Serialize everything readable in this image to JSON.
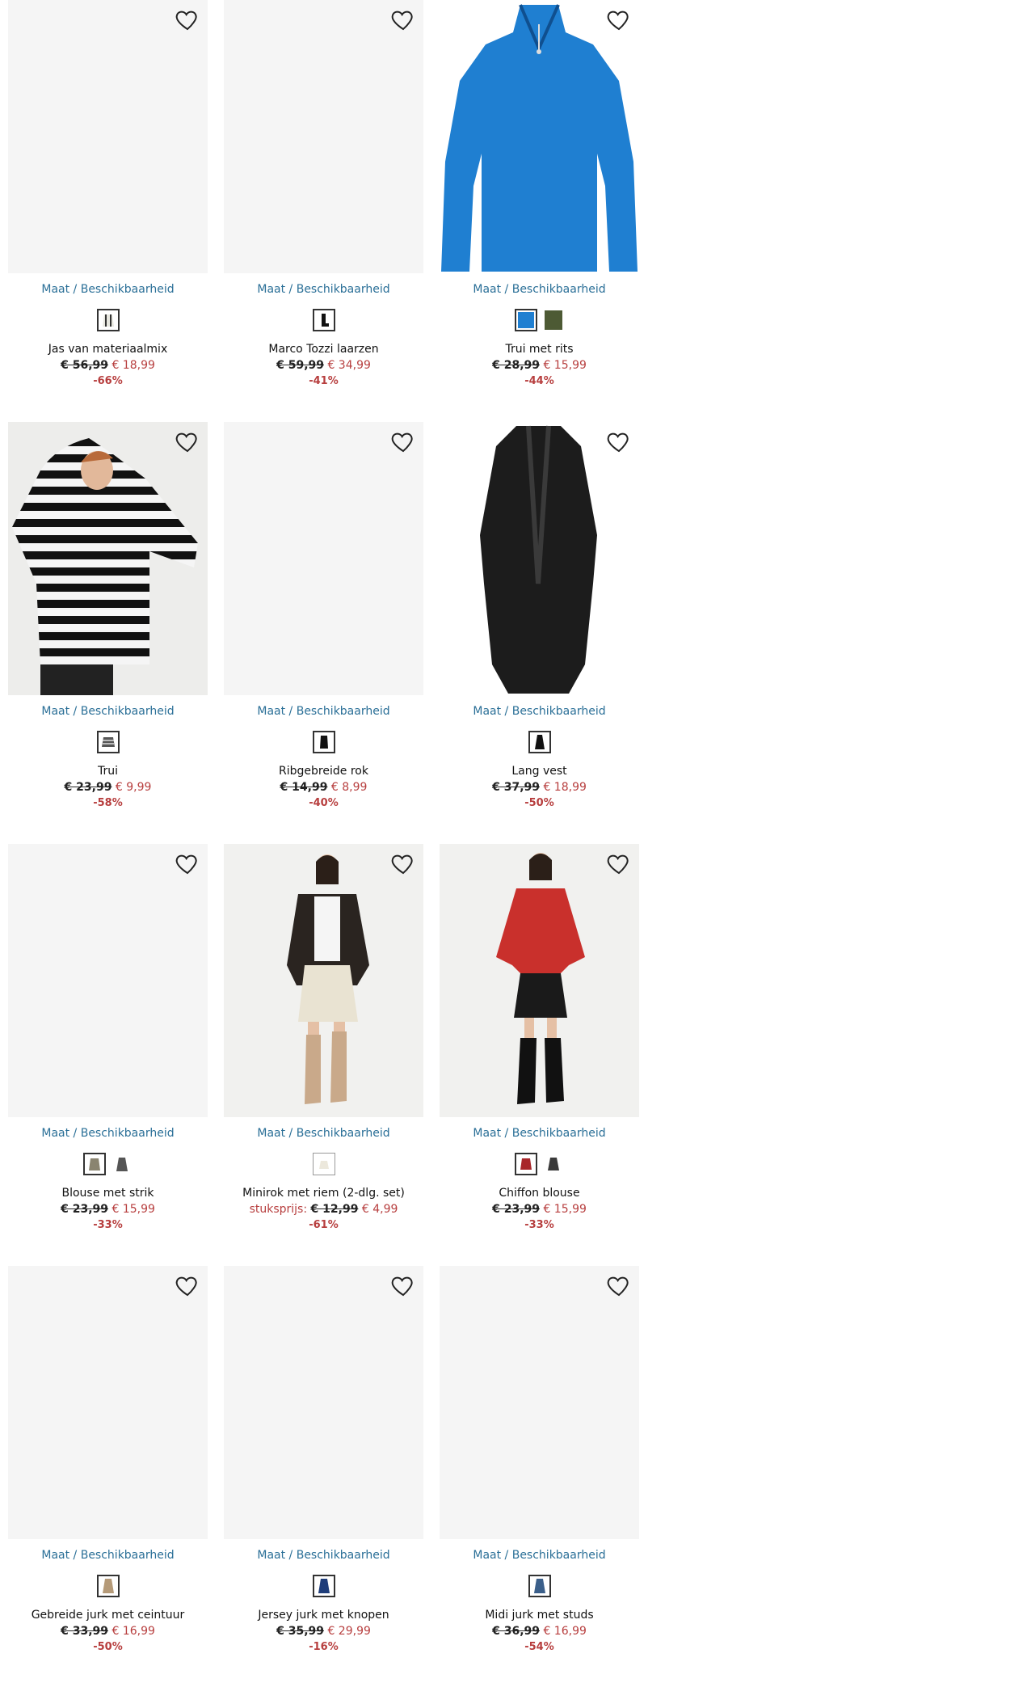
{
  "size_link": "Maat / Beschikbaarheid",
  "products": [
    {
      "title": "Jas van materiaalmix",
      "old_price": "€ 56,99",
      "new_price": "€ 18,99",
      "discount": "-66%"
    },
    {
      "title": "Marco Tozzi laarzen",
      "old_price": "€ 59,99",
      "new_price": "€ 34,99",
      "discount": "-41%"
    },
    {
      "title": "Trui met rits",
      "old_price": "€ 28,99",
      "new_price": "€ 15,99",
      "discount": "-44%"
    },
    {
      "title": "Trui",
      "old_price": "€ 23,99",
      "new_price": "€ 9,99",
      "discount": "-58%"
    },
    {
      "title": "Ribgebreide rok",
      "old_price": "€ 14,99",
      "new_price": "€ 8,99",
      "discount": "-40%"
    },
    {
      "title": "Lang vest",
      "old_price": "€ 37,99",
      "new_price": "€ 18,99",
      "discount": "-50%"
    },
    {
      "title": "Blouse met strik",
      "old_price": "€ 23,99",
      "new_price": "€ 15,99",
      "discount": "-33%"
    },
    {
      "title": "Minirok met riem (2-dlg. set)",
      "price_label": "stuksprijs:",
      "old_price": "€ 12,99",
      "new_price": "€ 4,99",
      "discount": "-61%"
    },
    {
      "title": "Chiffon blouse",
      "old_price": "€ 23,99",
      "new_price": "€ 15,99",
      "discount": "-33%"
    },
    {
      "title": "Gebreide jurk met ceintuur",
      "old_price": "€ 33,99",
      "new_price": "€ 16,99",
      "discount": "-50%"
    },
    {
      "title": "Jersey jurk met knopen",
      "old_price": "€ 35,99",
      "new_price": "€ 29,99",
      "discount": "-16%"
    },
    {
      "title": "Midi jurk met studs",
      "old_price": "€ 36,99",
      "new_price": "€ 16,99",
      "discount": "-54%"
    }
  ],
  "colors": {
    "link": "#2a6f97",
    "sale": "#b73e3e",
    "placeholder": "#f5f5f5"
  }
}
